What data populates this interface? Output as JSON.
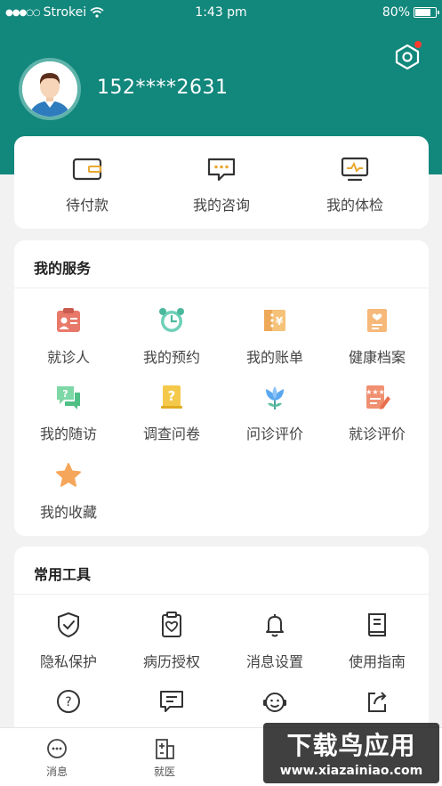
{
  "status_bar": {
    "carrier": "Strokei",
    "time": "1:43 pm",
    "battery": "80%",
    "battery_level": 0.8
  },
  "profile": {
    "phone": "152****2631"
  },
  "quick_actions": [
    {
      "label": "待付款",
      "icon": "wallet-icon"
    },
    {
      "label": "我的咨询",
      "icon": "chat-icon"
    },
    {
      "label": "我的体检",
      "icon": "monitor-icon"
    }
  ],
  "services": {
    "title": "我的服务",
    "items": [
      {
        "label": "就诊人",
        "icon": "patient-card-icon"
      },
      {
        "label": "我的预约",
        "icon": "alarm-clock-icon"
      },
      {
        "label": "我的账单",
        "icon": "bill-icon"
      },
      {
        "label": "健康档案",
        "icon": "health-record-icon"
      },
      {
        "label": "我的随访",
        "icon": "follow-up-icon"
      },
      {
        "label": "调查问卷",
        "icon": "questionnaire-icon"
      },
      {
        "label": "问诊评价",
        "icon": "tulip-icon"
      },
      {
        "label": "就诊评价",
        "icon": "review-icon"
      },
      {
        "label": "我的收藏",
        "icon": "star-icon"
      }
    ]
  },
  "tools": {
    "title": "常用工具",
    "items": [
      {
        "label": "隐私保护",
        "icon": "shield-icon"
      },
      {
        "label": "病历授权",
        "icon": "clipboard-heart-icon"
      },
      {
        "label": "消息设置",
        "icon": "bell-icon"
      },
      {
        "label": "使用指南",
        "icon": "book-icon"
      },
      {
        "label": "",
        "icon": "help-icon"
      },
      {
        "label": "",
        "icon": "feedback-icon"
      },
      {
        "label": "",
        "icon": "service-icon"
      },
      {
        "label": "",
        "icon": "share-icon"
      }
    ]
  },
  "tabbar": [
    {
      "label": "消息",
      "icon": "message-icon"
    },
    {
      "label": "就医",
      "icon": "hospital-icon"
    }
  ],
  "watermark": {
    "line1": "下载鸟应用",
    "line2": "www.xiazainiao.com"
  },
  "colors": {
    "brand": "#12877c",
    "notification": "#ff3b30"
  }
}
